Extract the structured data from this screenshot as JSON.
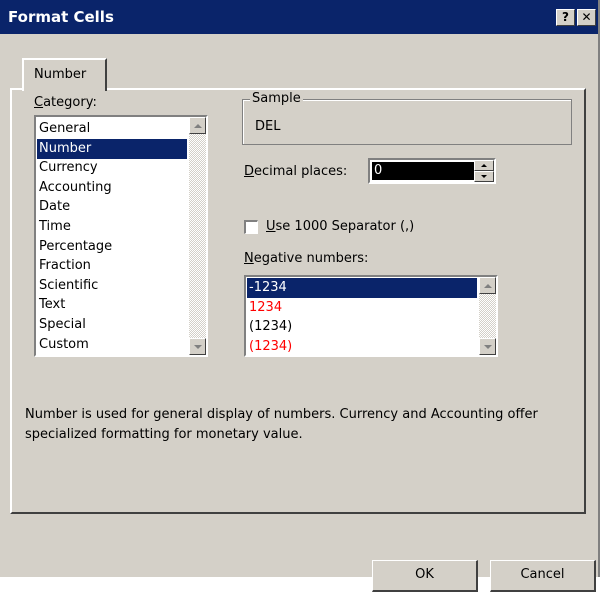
{
  "window": {
    "title": "Format Cells",
    "help_label": "?",
    "close_label": "✕"
  },
  "tabs": [
    {
      "label": "Number",
      "active": true
    }
  ],
  "category": {
    "label_first": "C",
    "label_rest": "ategory:",
    "items": [
      "General",
      "Number",
      "Currency",
      "Accounting",
      "Date",
      "Time",
      "Percentage",
      "Fraction",
      "Scientific",
      "Text",
      "Special",
      "Custom"
    ],
    "selected_index": 1
  },
  "sample": {
    "legend": "Sample",
    "value": "DEL"
  },
  "decimal_places": {
    "label_first": "D",
    "label_rest": "ecimal places:",
    "value": "0"
  },
  "separator": {
    "label_first": "U",
    "label_rest": "se 1000 Separator (,)",
    "checked": false
  },
  "negative_numbers": {
    "label_first": "N",
    "label_rest": "egative numbers:",
    "items": [
      {
        "text": "-1234",
        "color": "#000000"
      },
      {
        "text": "1234",
        "color": "#ff0000"
      },
      {
        "text": "(1234)",
        "color": "#000000"
      },
      {
        "text": "(1234)",
        "color": "#ff0000"
      }
    ],
    "selected_index": 0
  },
  "description": "Number is used for general display of numbers.  Currency and Accounting offer specialized formatting for monetary value.",
  "buttons": {
    "ok": "OK",
    "cancel": "Cancel"
  },
  "colors": {
    "titlebar": "#0a246a",
    "face": "#d4d0c8",
    "selection": "#0a246a",
    "negative_red": "#ff0000"
  },
  "icons": {
    "help": "help-icon",
    "close": "close-icon"
  }
}
